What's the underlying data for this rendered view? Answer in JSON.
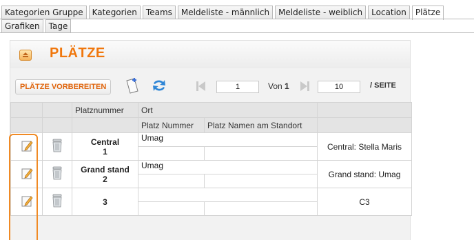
{
  "tabs_row1": [
    "Kategorien Gruppe",
    "Kategorien",
    "Teams",
    "Meldeliste - männlich",
    "Meldeliste - weiblich",
    "Location",
    "Plätze"
  ],
  "tabs_row2": [
    "Grafiken",
    "Tage"
  ],
  "active_tab": "Plätze",
  "panel": {
    "title": "PLÄTZE"
  },
  "toolbar": {
    "prepare_button": "PLÄTZE VORBEREITEN",
    "add_icon": "add-document-icon",
    "refresh_icon": "refresh-icon",
    "page_value": "1",
    "of_prefix": "Von",
    "of_total": "1",
    "per_page_value": "10",
    "per_page_label": "/ SEITE"
  },
  "table": {
    "headers": {
      "platznummer": "Platznummer",
      "ort": "Ort",
      "platz_nummer": "Platz Nummer",
      "platz_namen": "Platz Namen am Standort"
    },
    "rows": [
      {
        "name": "Central",
        "number": "1",
        "ort": "Umag",
        "label": "Central: Stella Maris"
      },
      {
        "name": "Grand stand",
        "number": "2",
        "ort": "Umag",
        "label": "Grand stand: Umag"
      },
      {
        "name": "",
        "number": "3",
        "ort": "",
        "label": "C3"
      }
    ]
  },
  "colors": {
    "accent": "#f0770d",
    "highlight_frame": "#f08a24"
  }
}
